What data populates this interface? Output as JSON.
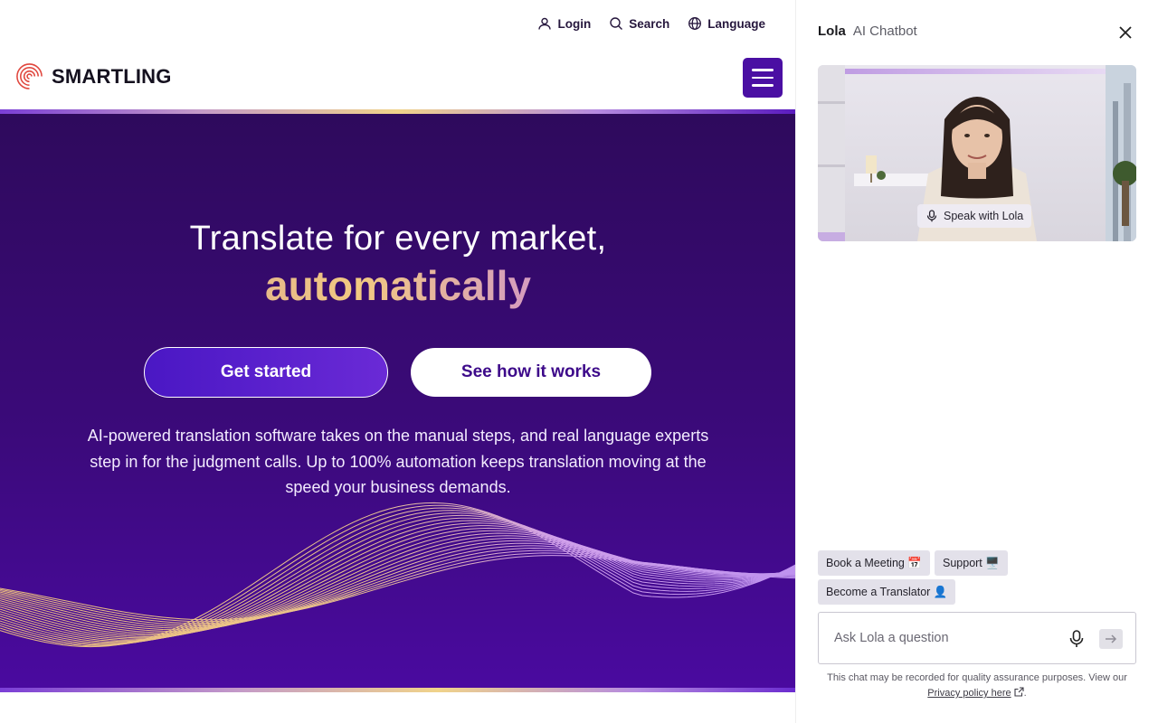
{
  "util_nav": {
    "login": "Login",
    "search": "Search",
    "language": "Language"
  },
  "brand": {
    "name": "SMARTLING"
  },
  "hero": {
    "headline": "Translate for every market,",
    "headline_accent": "automatically",
    "primary_cta": "Get started",
    "secondary_cta": "See how it works",
    "description": "AI-powered translation software takes on the manual steps, and real language experts step in for the judgment calls. Up to 100% automation keeps translation moving at the speed your business demands."
  },
  "chat": {
    "name": "Lola",
    "subtitle": "AI Chatbot",
    "speak_label": "Speak with Lola",
    "chips": [
      "Book a Meeting 📅",
      "Support 🖥️",
      "Become a Translator 👤"
    ],
    "input_placeholder": "Ask Lola a question",
    "disclaimer_text": "This chat may be recorded for quality assurance purposes. View our",
    "privacy_link": "Privacy policy here",
    "disclaimer_end": "."
  },
  "colors": {
    "brand_purple": "#4a0fa3",
    "hero_bg": "#3b0a7a",
    "logo_red": "#e0463d"
  }
}
